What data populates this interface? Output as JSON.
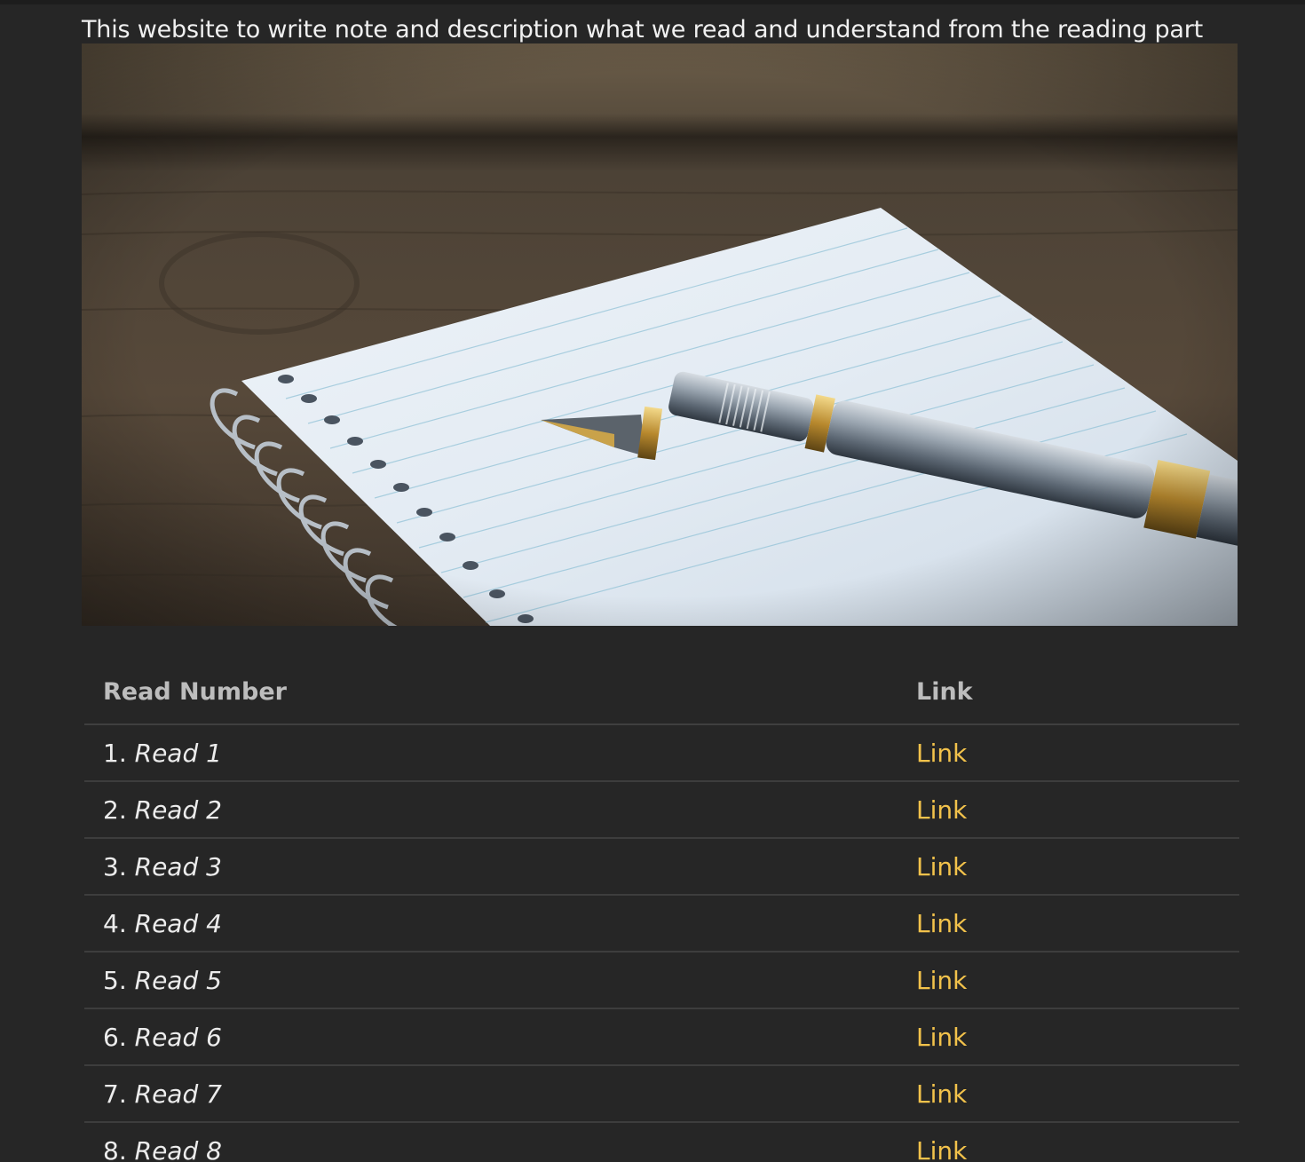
{
  "intro_text": "This website to write note and description what we read and understand from the reading part",
  "hero_image": {
    "description_icon": "notebook-with-fountain-pen-photo"
  },
  "table": {
    "headers": {
      "read_number": "Read Number",
      "link": "Link"
    },
    "rows": [
      {
        "index": "1.",
        "title": "Read 1",
        "link": "Link"
      },
      {
        "index": "2.",
        "title": "Read 2",
        "link": "Link"
      },
      {
        "index": "3.",
        "title": "Read 3",
        "link": "Link"
      },
      {
        "index": "4.",
        "title": "Read 4",
        "link": "Link"
      },
      {
        "index": "5.",
        "title": "Read 5",
        "link": "Link"
      },
      {
        "index": "6.",
        "title": "Read 6",
        "link": "Link"
      },
      {
        "index": "7.",
        "title": "Read 7",
        "link": "Link"
      },
      {
        "index": "8.",
        "title": "Read 8",
        "link": "Link"
      }
    ]
  },
  "colors": {
    "background": "#262626",
    "link": "#f2c24b",
    "header_text": "#bdbdbd"
  }
}
